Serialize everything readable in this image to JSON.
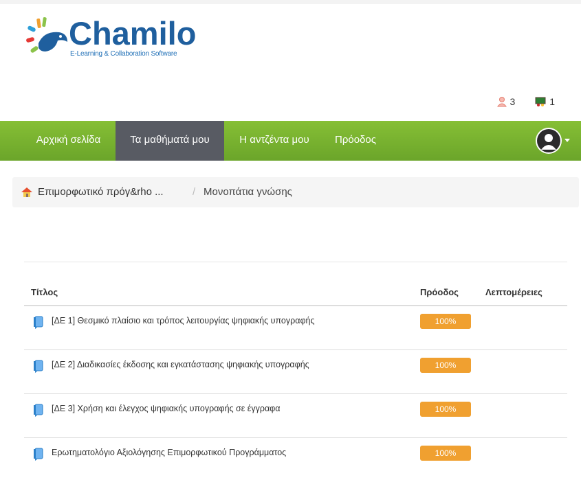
{
  "brand": {
    "name": "Chamilo",
    "tagline": "E-Learning & Collaboration Software"
  },
  "header_badges": [
    {
      "icon": "users-icon",
      "count": "3"
    },
    {
      "icon": "classroom-icon",
      "count": "1"
    }
  ],
  "nav": {
    "items": [
      {
        "label": "Αρχική σελίδα",
        "active": false
      },
      {
        "label": "Τα μαθήματά μου",
        "active": true
      },
      {
        "label": "Η αντζέντα μου",
        "active": false
      },
      {
        "label": "Πρόοδος",
        "active": false
      }
    ]
  },
  "breadcrumb": {
    "home_label": "Επιμορφωτικό πρόγ&rho ...",
    "separator": "/",
    "current": "Μονοπάτια γνώσης"
  },
  "table": {
    "headers": {
      "title": "Τίτλος",
      "progress": "Πρόοδος",
      "details": "Λεπτομέρειες"
    },
    "rows": [
      {
        "title": "[ΔΕ 1] Θεσμικό πλαίσιο και τρόπος λειτουργίας ψηφιακής υπογραφής",
        "progress": "100%"
      },
      {
        "title": "[ΔΕ 2] Διαδικασίες έκδοσης και εγκατάστασης ψηφιακής υπογραφής",
        "progress": "100%"
      },
      {
        "title": "[ΔΕ 3] Χρήση και έλεγχος ψηφιακής υπογραφής σε έγγραφα",
        "progress": "100%"
      },
      {
        "title": "Ερωτηματολόγιο Αξιολόγησης Επιμορφωτικού Προγράμματος",
        "progress": "100%"
      }
    ]
  },
  "colors": {
    "nav_green": "#78b22f",
    "nav_active": "#585b63",
    "progress": "#f0a030",
    "brand_blue": "#1f5f9e"
  }
}
